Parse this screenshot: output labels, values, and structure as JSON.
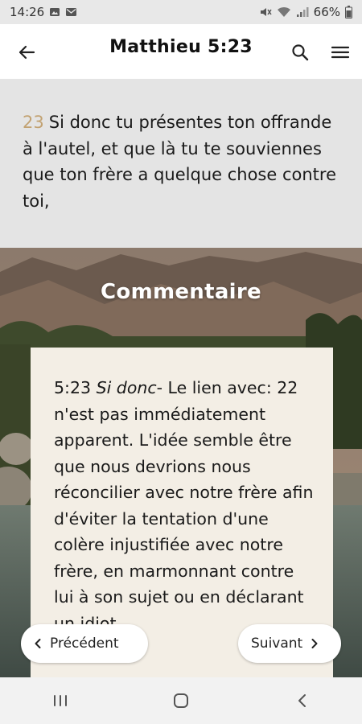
{
  "status_bar": {
    "time": "14:26",
    "battery": "66%",
    "icons": [
      "photo-icon",
      "mail-icon",
      "mute-icon",
      "wifi-icon",
      "signal-icon",
      "battery-icon"
    ]
  },
  "app_bar": {
    "title": "Matthieu 5:23",
    "icons": [
      "back-arrow-icon",
      "search-icon",
      "menu-icon"
    ]
  },
  "verse": {
    "number": "23",
    "text": "Si donc tu présentes ton offrande à l'autel, et que là tu te souviennes que ton frère a quelque chose contre toi,",
    "number_color": "#c2a272"
  },
  "commentary": {
    "heading": "Commentaire",
    "ref": "5:23",
    "italic_phrase": "Si donc",
    "text": "- Le lien avec: 22 n'est pas immédiatement apparent. L'idée semble être que nous devrions nous réconcilier avec notre frère afin d'éviter la tentation d'une colère injustifiée avec notre frère, en marmonnant contre lui à son sujet ou en déclarant un idiot."
  },
  "navigation": {
    "prev_label": "Précédent",
    "next_label": "Suivant"
  },
  "system_nav": {
    "icons": [
      "recents-icon",
      "home-icon",
      "back-icon"
    ]
  }
}
